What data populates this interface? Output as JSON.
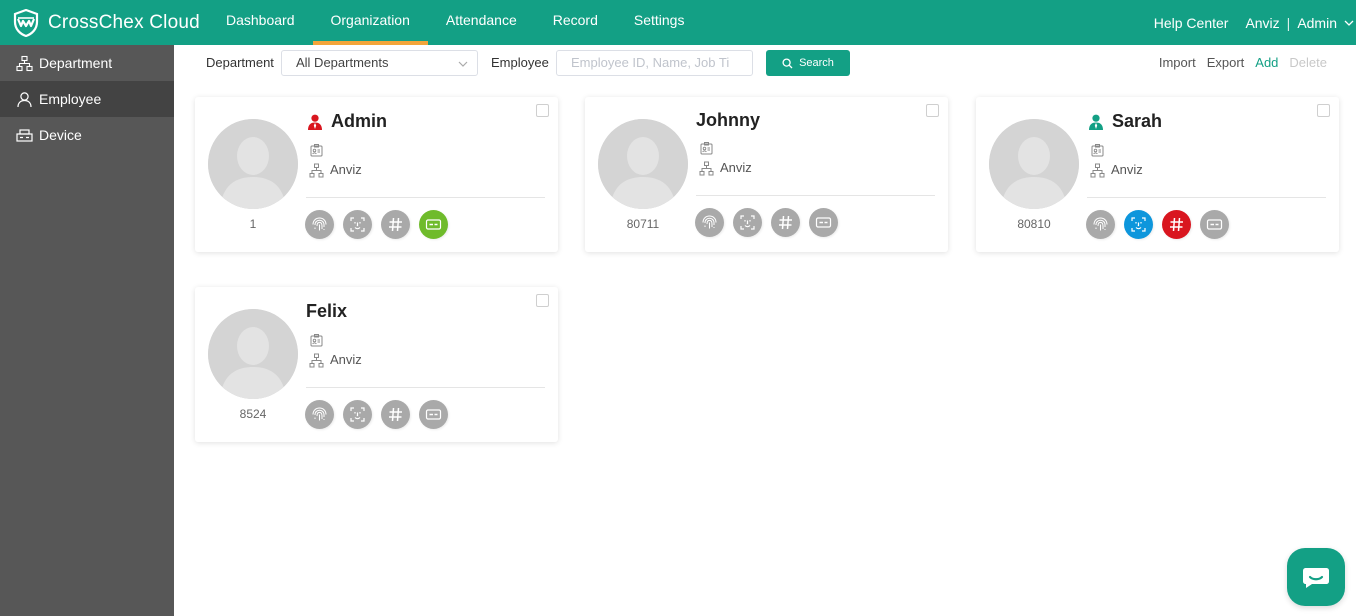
{
  "app": {
    "brand": "CrossChex Cloud",
    "accent": "#13a085",
    "tab_indicator": "#f3a53a"
  },
  "nav": [
    {
      "label": "Dashboard"
    },
    {
      "label": "Organization"
    },
    {
      "label": "Attendance"
    },
    {
      "label": "Record"
    },
    {
      "label": "Settings"
    }
  ],
  "header": {
    "help": "Help Center",
    "company": "Anviz",
    "separator": "|",
    "user": "Admin"
  },
  "sidebar": [
    {
      "label": "Department",
      "icon": "department-icon"
    },
    {
      "label": "Employee",
      "icon": "employee-icon"
    },
    {
      "label": "Device",
      "icon": "device-icon"
    }
  ],
  "toolbar": {
    "department_label": "Department",
    "department_value": "All Departments",
    "employee_label": "Employee",
    "employee_placeholder": "Employee ID, Name, Job Ti",
    "search_label": "Search",
    "import_label": "Import",
    "export_label": "Export",
    "add_label": "Add",
    "delete_label": "Delete"
  },
  "employees": [
    {
      "name": "Admin",
      "id": "1",
      "department": "Anviz",
      "role_icon": "admin-user-icon",
      "role_color": "#d9161f",
      "credentials": {
        "fingerprint": "inactive",
        "face": "inactive",
        "password": "inactive",
        "card": "active",
        "card_color": "#6fbb2b"
      }
    },
    {
      "name": "Johnny",
      "id": "80711",
      "department": "Anviz",
      "role_icon": "",
      "credentials": {
        "fingerprint": "inactive",
        "face": "inactive",
        "password": "inactive",
        "card": "inactive"
      }
    },
    {
      "name": "Sarah",
      "id": "80810",
      "department": "Anviz",
      "role_icon": "manager-user-icon",
      "role_color": "#13a085",
      "credentials": {
        "fingerprint": "inactive",
        "face": "active",
        "face_color": "#0d96dc",
        "password": "active",
        "password_color": "#d9161f",
        "card": "inactive"
      }
    },
    {
      "name": "Felix",
      "id": "8524",
      "department": "Anviz",
      "role_icon": "",
      "credentials": {
        "fingerprint": "inactive",
        "face": "inactive",
        "password": "inactive",
        "card": "inactive"
      }
    }
  ]
}
